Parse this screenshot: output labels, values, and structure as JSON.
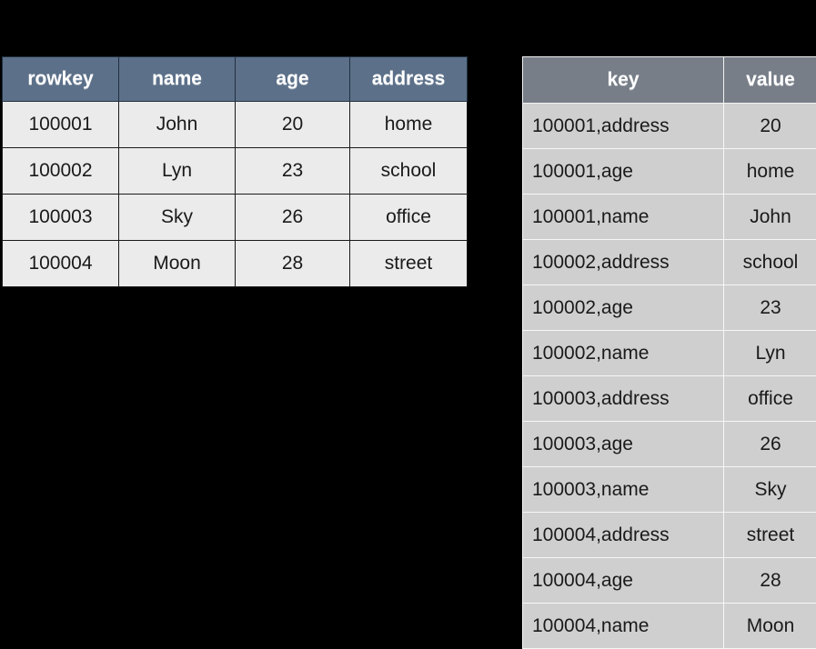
{
  "background_color": "#000000",
  "relational_table": {
    "name": "relational-row-table",
    "header_color": "#5c7089",
    "cell_color": "#ebebeb",
    "columns": [
      "rowkey",
      "name",
      "age",
      "address"
    ],
    "rows": [
      [
        "100001",
        "John",
        "20",
        "home"
      ],
      [
        "100002",
        "Lyn",
        "23",
        "school"
      ],
      [
        "100003",
        "Sky",
        "26",
        "office"
      ],
      [
        "100004",
        "Moon",
        "28",
        "street"
      ]
    ]
  },
  "keyvalue_table": {
    "name": "key-value-table",
    "header_color": "#777e88",
    "cell_color": "#cfcfcf",
    "columns": [
      "key",
      "value"
    ],
    "rows": [
      [
        "100001,address",
        "20"
      ],
      [
        "100001,age",
        "home"
      ],
      [
        "100001,name",
        "John"
      ],
      [
        "100002,address",
        "school"
      ],
      [
        "100002,age",
        "23"
      ],
      [
        "100002,name",
        "Lyn"
      ],
      [
        "100003,address",
        "office"
      ],
      [
        "100003,age",
        "26"
      ],
      [
        "100003,name",
        "Sky"
      ],
      [
        "100004,address",
        "street"
      ],
      [
        "100004,age",
        "28"
      ],
      [
        "100004,name",
        "Moon"
      ]
    ]
  }
}
